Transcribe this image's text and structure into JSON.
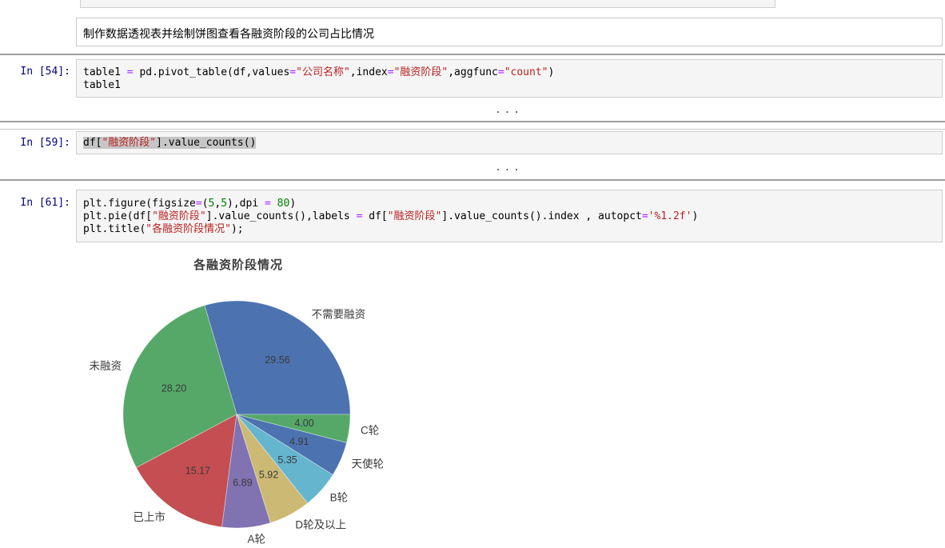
{
  "markdown_cell": {
    "text": "制作数据透视表并绘制饼图查看各融资阶段的公司占比情况"
  },
  "cells": [
    {
      "prompt": "In [54]:",
      "lines": [
        [
          {
            "t": "table1 "
          },
          {
            "t": "=",
            "c": "op"
          },
          {
            "t": " pd.pivot_table(df,values"
          },
          {
            "t": "=",
            "c": "op"
          },
          {
            "t": "\"公司名称\"",
            "c": "str"
          },
          {
            "t": ",index"
          },
          {
            "t": "=",
            "c": "op"
          },
          {
            "t": "\"融资阶段\"",
            "c": "str"
          },
          {
            "t": ",aggfunc"
          },
          {
            "t": "=",
            "c": "op"
          },
          {
            "t": "\"count\"",
            "c": "str"
          },
          {
            "t": ")"
          }
        ],
        [
          {
            "t": "table1"
          }
        ]
      ],
      "output_ellipsis": "..."
    },
    {
      "prompt": "In [59]:",
      "selected": true,
      "lines": [
        [
          {
            "t": "df["
          },
          {
            "t": "\"融资阶段\"",
            "c": "str"
          },
          {
            "t": "].value_counts()"
          }
        ]
      ],
      "output_ellipsis": "..."
    },
    {
      "prompt": "In [61]:",
      "lines": [
        [
          {
            "t": "plt.figure(figsize"
          },
          {
            "t": "=",
            "c": "op"
          },
          {
            "t": "("
          },
          {
            "t": "5",
            "c": "num"
          },
          {
            "t": ","
          },
          {
            "t": "5",
            "c": "num"
          },
          {
            "t": "),dpi "
          },
          {
            "t": "=",
            "c": "op"
          },
          {
            "t": " "
          },
          {
            "t": "80",
            "c": "num"
          },
          {
            "t": ")"
          }
        ],
        [
          {
            "t": "plt.pie(df["
          },
          {
            "t": "\"融资阶段\"",
            "c": "str"
          },
          {
            "t": "].value_counts(),labels "
          },
          {
            "t": "=",
            "c": "op"
          },
          {
            "t": " df["
          },
          {
            "t": "\"融资阶段\"",
            "c": "str"
          },
          {
            "t": "].value_counts().index , autopct"
          },
          {
            "t": "=",
            "c": "op"
          },
          {
            "t": "'%1.2f'",
            "c": "str"
          },
          {
            "t": ")"
          }
        ],
        [
          {
            "t": "plt.title("
          },
          {
            "t": "\"各融资阶段情况\"",
            "c": "str"
          },
          {
            "t": ");"
          }
        ]
      ]
    }
  ],
  "chart_data": {
    "type": "pie",
    "title": "各融资阶段情况",
    "start_angle_deg": 0,
    "direction": "counterclockwise",
    "autopct": "%1.2f",
    "label_distance": 1.1,
    "pct_distance": 0.6,
    "slices": [
      {
        "label": "不需要融资",
        "value": 29.56,
        "color": "#4C72B0"
      },
      {
        "label": "未融资",
        "value": 28.2,
        "color": "#55A868"
      },
      {
        "label": "已上市",
        "value": 15.17,
        "color": "#C44E52"
      },
      {
        "label": "A轮",
        "value": 6.89,
        "color": "#8172B2"
      },
      {
        "label": "D轮及以上",
        "value": 5.92,
        "color": "#CCB974"
      },
      {
        "label": "B轮",
        "value": 5.35,
        "color": "#64B5CD"
      },
      {
        "label": "天使轮",
        "value": 4.91,
        "color": "#4C72B0"
      },
      {
        "label": "C轮",
        "value": 4.0,
        "color": "#55A868"
      }
    ]
  }
}
